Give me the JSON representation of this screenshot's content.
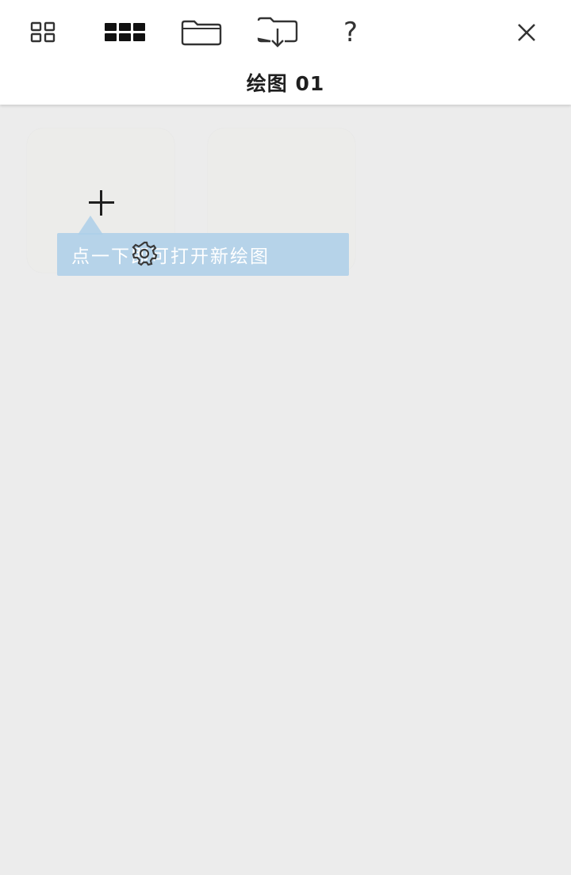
{
  "toolbar": {
    "icons": [
      "grid-small-icon",
      "grid-large-icon",
      "folder-icon",
      "import-icon",
      "help-icon",
      "close-icon"
    ],
    "help_label": "?"
  },
  "header": {
    "title": "绘图 01"
  },
  "gallery": {
    "new_card_icon": "plus-icon",
    "tooltip": "点一下即可打开新绘图"
  }
}
